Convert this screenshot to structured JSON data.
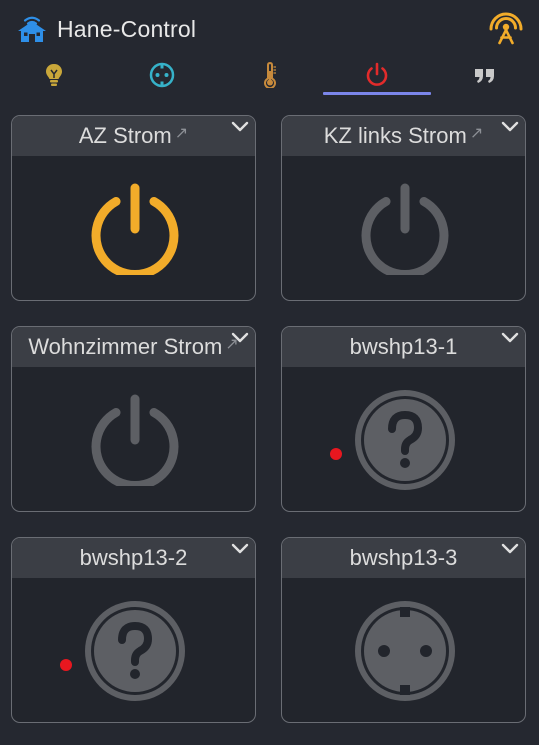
{
  "app": {
    "title": "Hane-Control"
  },
  "colors": {
    "background": "#252830",
    "card_header": "#3b3e45",
    "accent_active": "#f2ac2a",
    "inactive_icon": "#5d5f64",
    "tab_indicator": "#7b86ea",
    "error_dot": "#e8171f",
    "header_icon_blue": "#2e8fe8"
  },
  "tabs": [
    {
      "icon": "lightbulb-icon",
      "color": "#c9a73a"
    },
    {
      "icon": "socket-icon",
      "color": "#36b2c9"
    },
    {
      "icon": "thermometer-icon",
      "color": "#c78a3c"
    },
    {
      "icon": "power-icon",
      "color": "#e22b2b",
      "active": true
    },
    {
      "icon": "quote-icon",
      "color": "#c9c9c9"
    }
  ],
  "cards": [
    {
      "title": "AZ Strom",
      "icon": "power-icon",
      "state": "on",
      "external_link": true
    },
    {
      "title": "KZ links Strom",
      "icon": "power-icon",
      "state": "off",
      "external_link": true
    },
    {
      "title": "Wohnzimmer Strom",
      "icon": "power-icon",
      "state": "off",
      "external_link": true
    },
    {
      "title": "bwshp13-1",
      "icon": "unknown-socket-icon",
      "state": "unknown",
      "error_dot": true
    },
    {
      "title": "bwshp13-2",
      "icon": "unknown-socket-icon",
      "state": "unknown",
      "error_dot": true
    },
    {
      "title": "bwshp13-3",
      "icon": "socket-icon",
      "state": "off"
    }
  ]
}
